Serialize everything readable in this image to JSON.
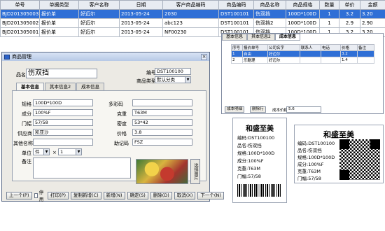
{
  "grid": {
    "headers": [
      "单号",
      "单据类型",
      "客户名称",
      "日期",
      "客户商品编码",
      "商品编码",
      "商品名称",
      "商品规格",
      "数量",
      "单价",
      "金额"
    ],
    "rows": [
      [
        "BJD201305003",
        "报价单",
        "好迈尔",
        "2013-05-24",
        "2030",
        "DST100101",
        "伤双挡",
        "100D*100D",
        "1",
        "3.2",
        "3.20"
      ],
      [
        "BJD201305002",
        "报价单",
        "好迈尔",
        "2013-05-24",
        "abc123",
        "DST100101",
        "伤双挡2",
        "100D*100D",
        "1",
        "2.9",
        "2.90"
      ],
      [
        "BJD201305001",
        "报价单",
        "好迈尔",
        "2013-05-24",
        "NF00230",
        "DST100101",
        "伤双挡",
        "100D*100D",
        "1",
        "3.2",
        "3.20"
      ]
    ]
  },
  "dialog": {
    "title": "商品管理",
    "close": "×",
    "name_label": "品名",
    "name_value": "伤双挡",
    "code_label": "编号",
    "code_value": "DST100100",
    "category_label": "商品类型",
    "category_value": "默认分类",
    "tabs": [
      "基本信息",
      "其本信息2",
      "成本信息"
    ],
    "fields": {
      "spec_label": "规格",
      "spec_value": "100D*100D",
      "extra_label": "多彩码",
      "extra_value": "",
      "composition_label": "成分",
      "composition_value": "100%F",
      "weight_label": "克重",
      "weight_value": "T63M",
      "width_label": "门幅",
      "width_value": "57/58",
      "density_label": "密度",
      "density_value": "53*42",
      "supplier_label": "供应商",
      "supplier_value": "凯亚沙",
      "price_label": "价格",
      "price_value": "3.8",
      "alias_label": "其他名称",
      "alias_value": "",
      "mnemonic_label": "助记码",
      "mnemonic_value": "FSZ",
      "unit_label": "单位",
      "unit_value": "件",
      "unit_times": "×",
      "unit_qty": "1",
      "note_label": "备注"
    },
    "pick_button": "选择图片",
    "buttons": {
      "prev": "上一个(P)",
      "disable": "停用",
      "print": "打印(P)",
      "copy_new": "复制新增(C)",
      "new": "新增(N)",
      "ok": "确定(S)",
      "delete": "删除(D)",
      "cancel": "取消(X)",
      "next": "下一个(N)"
    }
  },
  "subwin": {
    "tabs": [
      "基本信息",
      "其本信息2",
      "成本信息"
    ],
    "headers": [
      "序号",
      "报价单号",
      "公司名字",
      "联系人",
      "电话",
      "价格",
      "备注"
    ],
    "rows": [
      [
        "1",
        "自由",
        "好迈尔",
        "",
        "",
        "3.2",
        ""
      ],
      [
        "2",
        "乐酷理",
        "好迈尔",
        "",
        "",
        "1.4",
        ""
      ]
    ],
    "foot_left": "成本明细",
    "foot_mid": "删除行",
    "foot_label": "成本价格",
    "foot_value": "5.6"
  },
  "label_small": {
    "title": "和盛至美",
    "lines": [
      "编码:DST100100",
      "品名:伤双挡",
      "规格:100D*100D",
      "成分:100%F",
      "克重:T63M",
      "门幅:57/58"
    ]
  },
  "label_large": {
    "title": "和盛至美",
    "lines": [
      "编码:DST100100",
      "品名:伤双挡",
      "规格:100D*100D",
      "成分:100%F",
      "克重:T63M",
      "门幅:57/58"
    ]
  },
  "colors": {
    "selection": "#2f6fd6",
    "dialog_bg": "#eceae4"
  }
}
